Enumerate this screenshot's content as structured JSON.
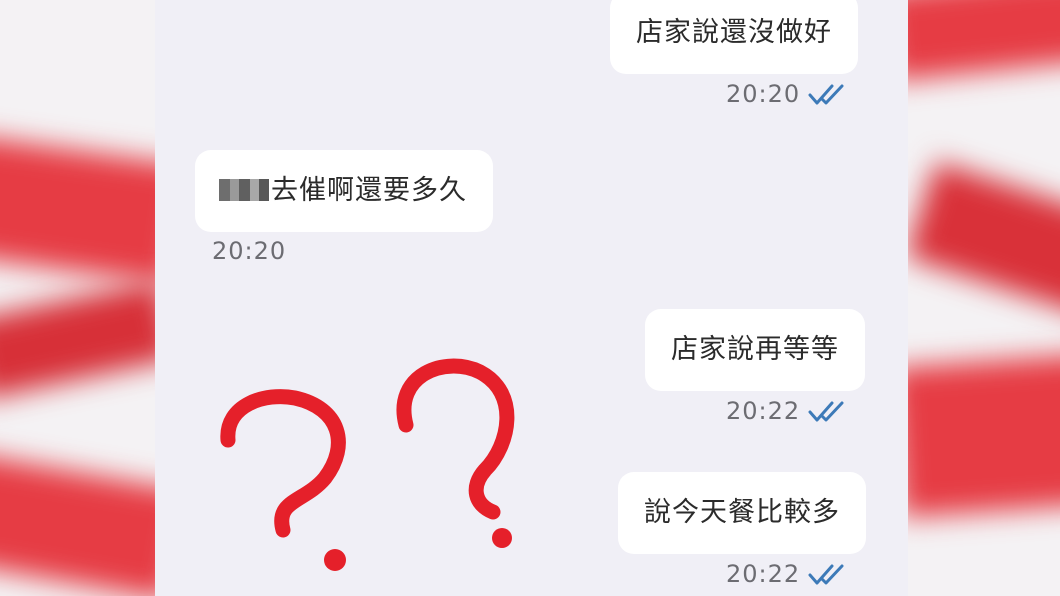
{
  "messages": [
    {
      "side": "outgoing",
      "text": "店家說還沒做好",
      "time": "20:20",
      "read_icon": "double-check-icon"
    },
    {
      "side": "incoming",
      "text": "去催啊還要多久",
      "time": "20:20",
      "redacted_prefix": true
    },
    {
      "side": "outgoing",
      "text": "店家說再等等",
      "time": "20:22",
      "read_icon": "double-check-icon"
    },
    {
      "side": "outgoing",
      "text": "說今天餐比較多",
      "time": "20:22",
      "read_icon": "double-check-icon"
    }
  ],
  "annotation": {
    "symbols": "??",
    "color": "#e5202a"
  },
  "colors": {
    "chat_background": "#f0eff6",
    "bubble": "#ffffff",
    "checkmark": "#3d7ab8",
    "side_red": "#e63c44"
  }
}
